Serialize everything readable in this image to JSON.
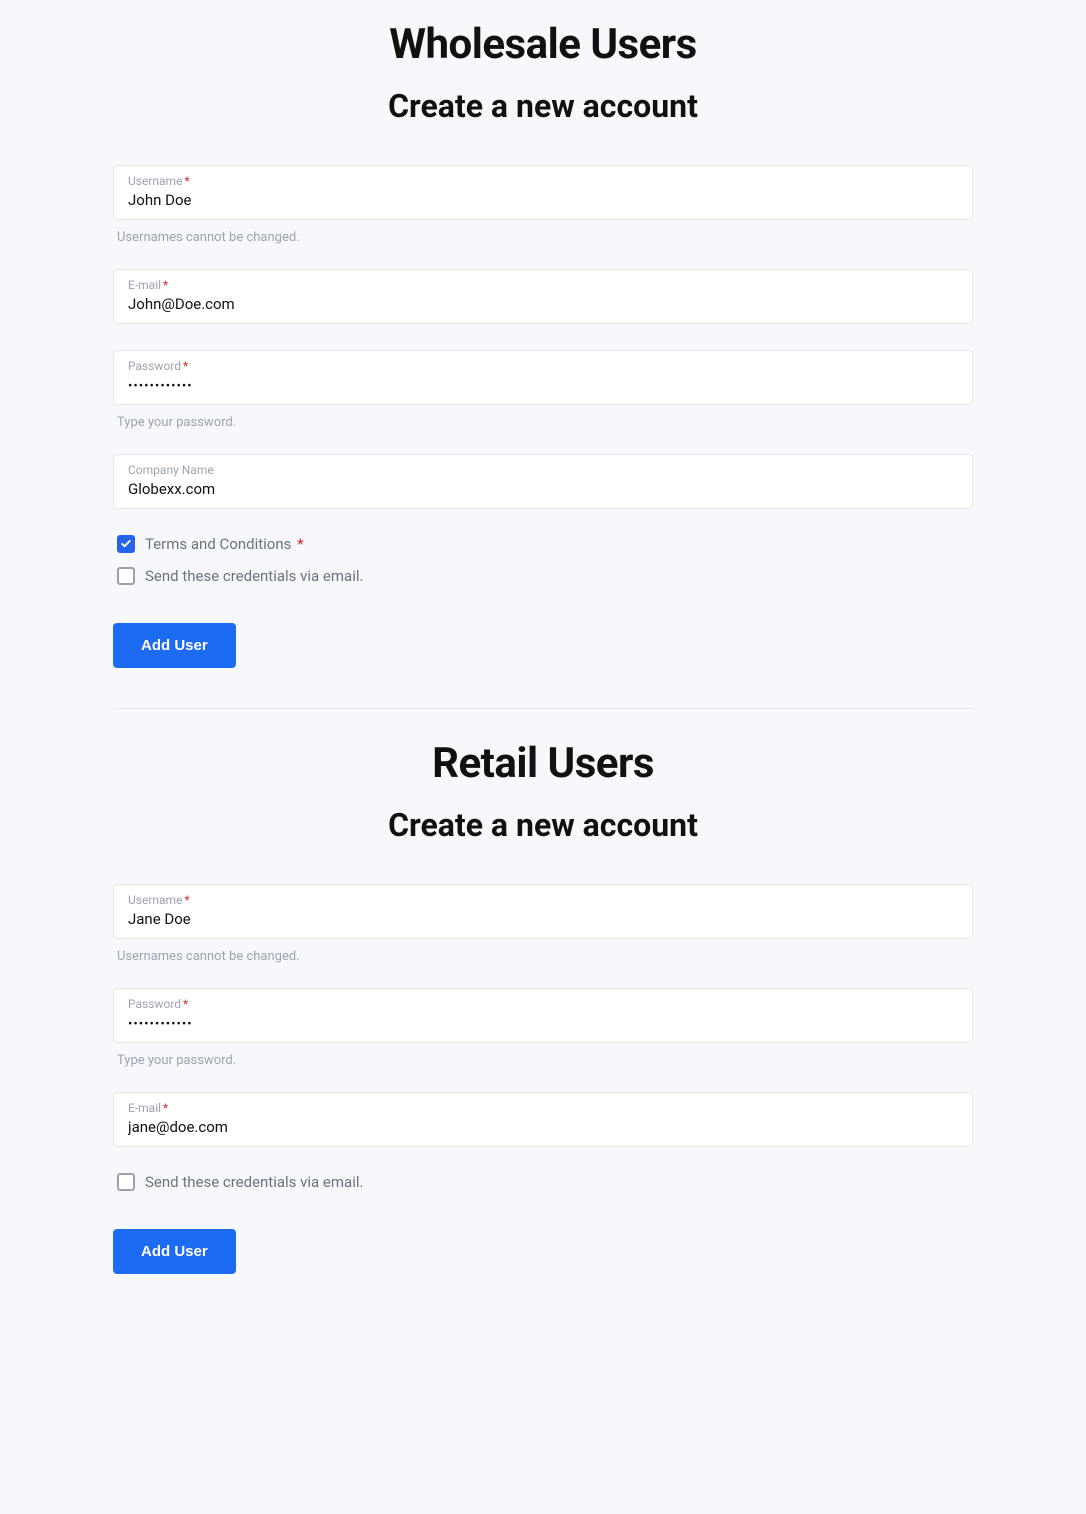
{
  "wholesale": {
    "title": "Wholesale Users",
    "subtitle": "Create a new account",
    "username": {
      "label": "Username",
      "value": "John Doe",
      "helper": "Usernames cannot be changed."
    },
    "email": {
      "label": "E-mail",
      "value": "John@Doe.com"
    },
    "password": {
      "label": "Password",
      "value": "••••••••••••",
      "helper": "Type your password."
    },
    "company": {
      "label": "Company Name",
      "value": "Globexx.com"
    },
    "terms": {
      "label": "Terms and Conditions",
      "checked": true
    },
    "send_creds": {
      "label": "Send these credentials via email.",
      "checked": false
    },
    "submit": "Add User"
  },
  "retail": {
    "title": "Retail Users",
    "subtitle": "Create a new account",
    "username": {
      "label": "Username",
      "value": "Jane Doe",
      "helper": "Usernames cannot be changed."
    },
    "password": {
      "label": "Password",
      "value": "••••••••••••",
      "helper": "Type your password."
    },
    "email": {
      "label": "E-mail",
      "value": "jane@doe.com"
    },
    "send_creds": {
      "label": "Send these credentials via email.",
      "checked": false
    },
    "submit": "Add User"
  }
}
